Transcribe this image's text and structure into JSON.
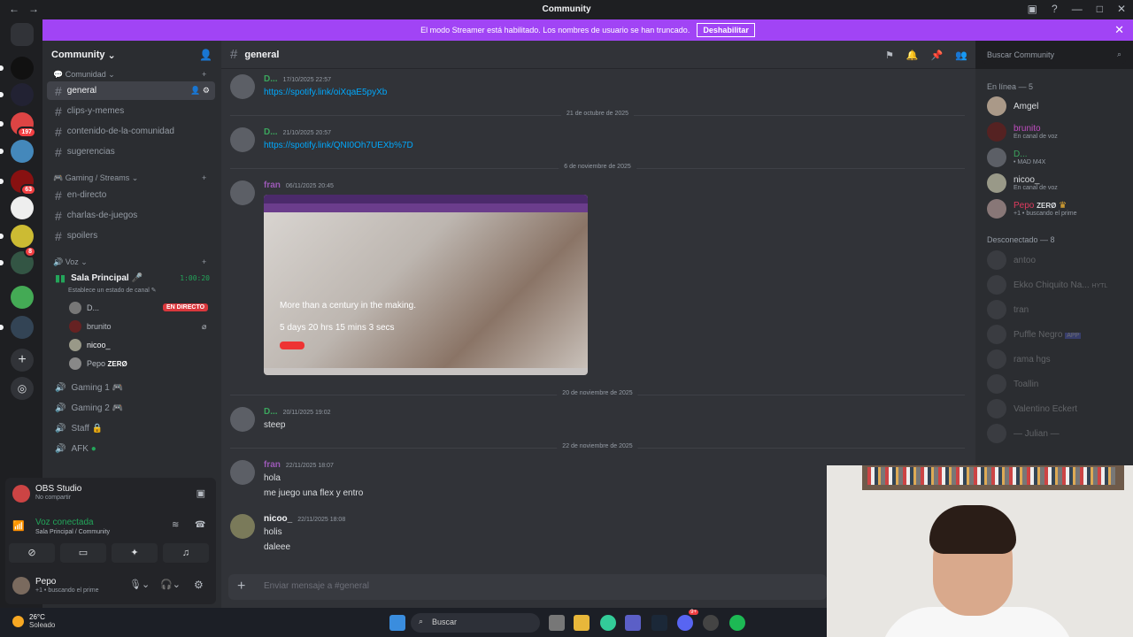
{
  "window": {
    "title": "Community",
    "back": "←",
    "forward": "→"
  },
  "banner": {
    "text": "El modo Streamer está habilitado. Los nombres de usuario se han truncado.",
    "button": "Deshabilitar"
  },
  "server": {
    "name": "Community",
    "categories": [
      {
        "label": "Comunidad"
      },
      {
        "label": "Gaming / Streams"
      },
      {
        "label": "Voz"
      }
    ],
    "text_channels": [
      "general",
      "clips-y-memes",
      "contenido-de-la-comunidad",
      "sugerencias",
      "en-directo",
      "charlas-de-juegos",
      "spoilers"
    ],
    "voice_main": {
      "name": "Sala Principal",
      "status": "Establece un estado de canal",
      "timer": "1:00:20"
    },
    "voice_users": [
      {
        "name": "D...",
        "live": "EN DIRECTO"
      },
      {
        "name": "brunito"
      },
      {
        "name": "nicoo_"
      },
      {
        "name": "Pepo",
        "tag": "ZERØ"
      }
    ],
    "voice_channels": [
      "Gaming 1",
      "Gaming 2",
      "Staff",
      "AFK"
    ]
  },
  "server_badges": [
    "197",
    "63",
    "8"
  ],
  "user_panel": {
    "obs_name": "OBS Studio",
    "obs_status": "No compartir",
    "voice_state": "Voz conectada",
    "voice_location": "Sala Principal / Community",
    "user_name": "Pepo",
    "user_status": "+1 • buscando el prime"
  },
  "chat": {
    "channel": "general",
    "search_placeholder": "Buscar Community",
    "composer_placeholder": "Enviar mensaje a #general",
    "messages": [
      {
        "author": "D...",
        "time": "17/10/2025 22:57",
        "lines": [
          "https://spotify.link/oiXqaE5pyXb"
        ]
      },
      {
        "author": "D...",
        "time": "21/10/2025 20:57",
        "lines": [
          "https://spotify.link/QNI0Oh7UEXb%7D"
        ]
      },
      {
        "author": "fran",
        "time": "06/11/2025 20:45",
        "lines": []
      },
      {
        "author": "D...",
        "time": "20/11/2025 19:02",
        "lines": [
          "steep"
        ]
      },
      {
        "author": "fran",
        "time": "22/11/2025 18:07",
        "lines": [
          "hola",
          "me juego una flex y entro"
        ]
      },
      {
        "author": "nicoo_",
        "time": "22/11/2025 18:08",
        "lines": [
          "holis",
          "daleee"
        ]
      }
    ],
    "dividers": [
      "21 de octubre de 2025",
      "6 de noviembre de 2025",
      "20 de noviembre de 2025",
      "22 de noviembre de 2025"
    ],
    "embed": {
      "headline": "More than a century in the making.",
      "countdown": "5 days 20 hrs 15 mins 3 secs"
    }
  },
  "members": {
    "online_header": "En línea — 5",
    "online": [
      {
        "name": "Amgel",
        "status": ""
      },
      {
        "name": "brunito",
        "status": "En canal de voz"
      },
      {
        "name": "D...",
        "status": "• MAD M4X"
      },
      {
        "name": "nicoo_",
        "status": "En canal de voz"
      },
      {
        "name": "Pepo",
        "tag": "ZERØ",
        "status": "+1 • buscando el prime"
      }
    ],
    "offline_header": "Desconectado — 8",
    "offline": [
      "antoo",
      "Ekko Chiquito Na...",
      "tran",
      "Puffle Negro",
      "rama hgs",
      "Toallin",
      "Valentino Eckert",
      "— Julian —"
    ],
    "offline_tags": {
      "ekko": "HYTL",
      "puffle": "APP"
    }
  },
  "taskbar": {
    "temp": "26°C",
    "condition": "Soleado",
    "search": "Buscar",
    "discord_badge": "9+"
  }
}
